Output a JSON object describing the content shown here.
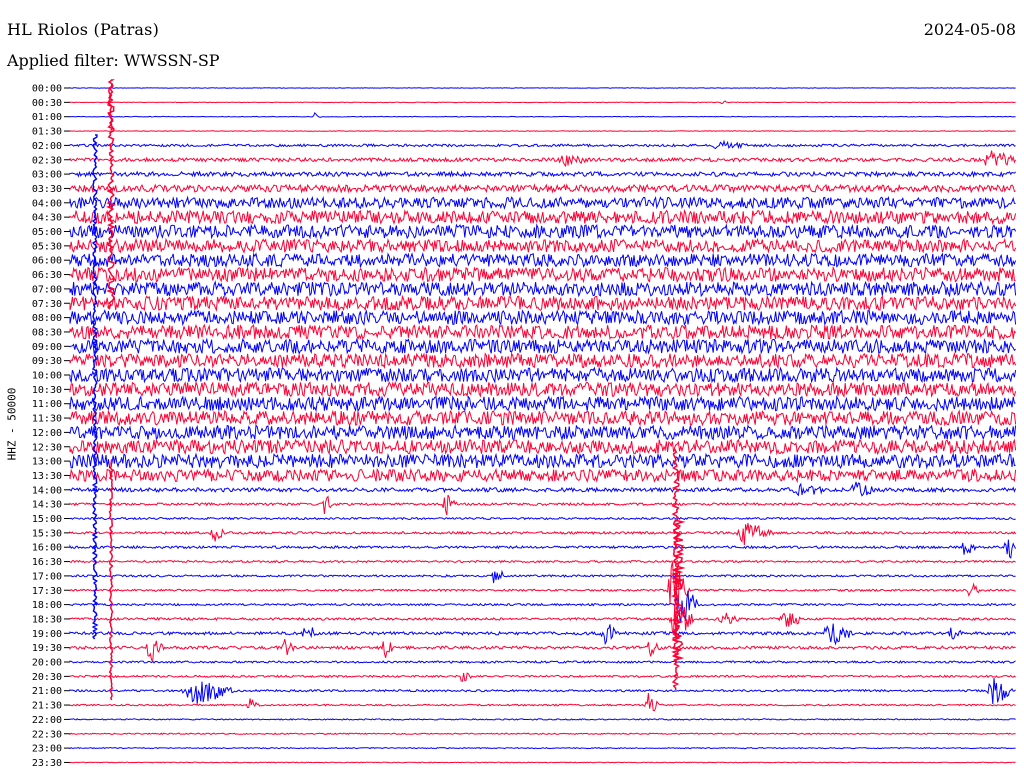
{
  "header": {
    "station": "HL Riolos (Patras)",
    "date": "2024-05-08",
    "filter": "Applied filter: WWSSN-SP"
  },
  "y_axis_label": "HHZ - 50000",
  "colors": {
    "trace_a": "#0000ff",
    "trace_b": "#ff0033"
  },
  "chart_data": {
    "type": "seismogram",
    "rows": [
      {
        "time": "00:00",
        "noise": 0.2
      },
      {
        "time": "00:30",
        "noise": 0.3
      },
      {
        "time": "01:00",
        "noise": 0.3
      },
      {
        "time": "01:30",
        "noise": 0.3
      },
      {
        "time": "02:00",
        "noise": 1.2
      },
      {
        "time": "02:30",
        "noise": 1.8
      },
      {
        "time": "03:00",
        "noise": 2.2
      },
      {
        "time": "03:30",
        "noise": 3.5
      },
      {
        "time": "04:00",
        "noise": 5.5
      },
      {
        "time": "04:30",
        "noise": 6.5
      },
      {
        "time": "05:00",
        "noise": 6.5
      },
      {
        "time": "05:30",
        "noise": 6.5
      },
      {
        "time": "06:00",
        "noise": 6.5
      },
      {
        "time": "06:30",
        "noise": 7
      },
      {
        "time": "07:00",
        "noise": 7
      },
      {
        "time": "07:30",
        "noise": 7
      },
      {
        "time": "08:00",
        "noise": 7
      },
      {
        "time": "08:30",
        "noise": 7
      },
      {
        "time": "09:00",
        "noise": 7
      },
      {
        "time": "09:30",
        "noise": 7
      },
      {
        "time": "10:00",
        "noise": 7
      },
      {
        "time": "10:30",
        "noise": 7
      },
      {
        "time": "11:00",
        "noise": 7
      },
      {
        "time": "11:30",
        "noise": 7
      },
      {
        "time": "12:00",
        "noise": 7
      },
      {
        "time": "12:30",
        "noise": 7
      },
      {
        "time": "13:00",
        "noise": 7
      },
      {
        "time": "13:30",
        "noise": 6
      },
      {
        "time": "14:00",
        "noise": 2
      },
      {
        "time": "14:30",
        "noise": 1.2
      },
      {
        "time": "15:00",
        "noise": 1
      },
      {
        "time": "15:30",
        "noise": 1.2
      },
      {
        "time": "16:00",
        "noise": 1.2
      },
      {
        "time": "16:30",
        "noise": 1
      },
      {
        "time": "17:00",
        "noise": 1
      },
      {
        "time": "17:30",
        "noise": 1
      },
      {
        "time": "18:00",
        "noise": 1
      },
      {
        "time": "18:30",
        "noise": 1.2
      },
      {
        "time": "19:00",
        "noise": 1.5
      },
      {
        "time": "19:30",
        "noise": 1.5
      },
      {
        "time": "20:00",
        "noise": 1
      },
      {
        "time": "20:30",
        "noise": 1
      },
      {
        "time": "21:00",
        "noise": 1
      },
      {
        "time": "21:30",
        "noise": 0.8
      },
      {
        "time": "22:00",
        "noise": 0.6
      },
      {
        "time": "22:30",
        "noise": 0.6
      },
      {
        "time": "23:00",
        "noise": 0.5
      },
      {
        "time": "23:30",
        "noise": 0.4
      }
    ]
  }
}
